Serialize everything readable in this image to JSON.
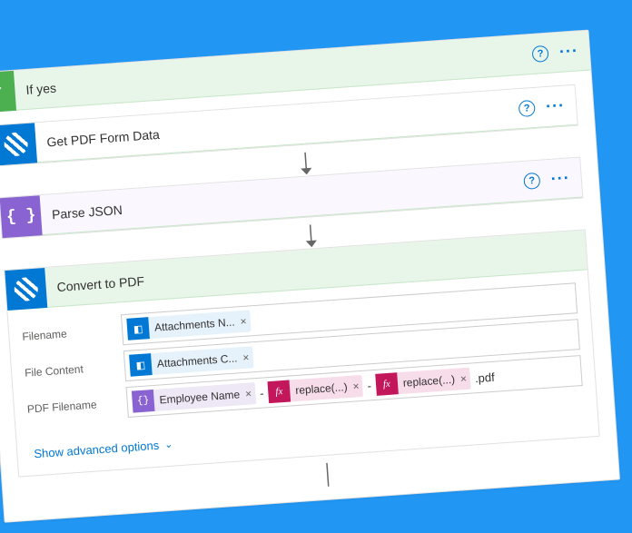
{
  "ifYes": {
    "title": "If yes"
  },
  "getPdf": {
    "title": "Get PDF Form Data"
  },
  "parseJson": {
    "title": "Parse JSON"
  },
  "convertPdf": {
    "title": "Convert to PDF",
    "fields": {
      "filename": {
        "label": "Filename",
        "tokens": {
          "attachName": "Attachments N..."
        }
      },
      "fileContent": {
        "label": "File Content",
        "tokens": {
          "attachContent": "Attachments C..."
        }
      },
      "pdfFilename": {
        "label": "PDF Filename",
        "tokens": {
          "employee": "Employee Name",
          "replace1": "replace(...)",
          "replace2": "replace(...)"
        },
        "literals": {
          "sep": "-",
          "ext": ".pdf"
        }
      }
    },
    "advanced": "Show advanced options"
  }
}
